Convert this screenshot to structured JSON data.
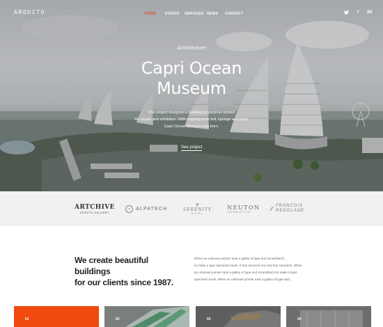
{
  "header": {
    "brand": "ARQUITO",
    "nav": [
      {
        "label": "HOME",
        "active": true
      },
      {
        "label": "STUDIO",
        "active": false
      },
      {
        "label": "SERVICES",
        "active": false
      },
      {
        "label": "NEWS",
        "active": false
      },
      {
        "label": "CONTACT",
        "active": false
      }
    ],
    "social": [
      {
        "icon": "twitter-icon",
        "glyph": "🐦"
      },
      {
        "icon": "facebook-icon",
        "glyph": "f"
      },
      {
        "icon": "behance-icon",
        "glyph": "Bē"
      }
    ]
  },
  "hero": {
    "tag": "Architecture",
    "title_line1": "Capri Ocean",
    "title_line2": "Museum",
    "desc_line1": "This project designed a building for purpose protect",
    "desc_line2": "the ocean and exhibition. With inspired from sell, sponge and sand,",
    "desc_line3": "Capri Ocean Museum was born.",
    "link": "See project"
  },
  "clients": {
    "archive_main": "ARTCHIVE",
    "archive_sub": "CRAFTS GALLERY",
    "alpatech_badge": "AT",
    "alpatech": "ALPATECH",
    "serenity": "SERENITY",
    "serenity_sub": "HOTEL",
    "neuton": "NEUTON",
    "neuton_sub": "INTERACTIVE",
    "redglade_l1": "FRANCOIS",
    "redglade_l2": "REDGLADE"
  },
  "about": {
    "heading_line1": "We create beautiful buildings",
    "heading_line2": "for our clients since 1987.",
    "text_line1": "When an unknown printer took a galley of type and scrambled it",
    "text_line2": "to make a type specimen book. It has survived not only five centuries. When",
    "text_line3": "an unknown printer took a galley of type and scrambled it to make a type",
    "text_line4": "specimen book. When an unknown printer took a galley of type and."
  },
  "cards": [
    {
      "num": "01"
    },
    {
      "num": "02"
    },
    {
      "num": "03"
    },
    {
      "num": "04"
    }
  ],
  "colors": {
    "accent": "#f04a0e"
  }
}
